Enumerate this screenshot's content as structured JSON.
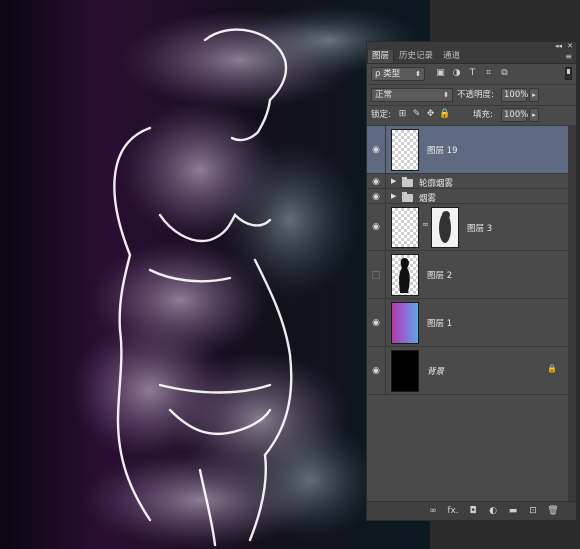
{
  "canvas": {
    "background": "#0b0b14",
    "accent_purple": "#5a2a6e",
    "accent_teal": "#1e4a56"
  },
  "panel": {
    "collapse_glyph": "◂◂",
    "close_glyph": "✕",
    "tabs": [
      {
        "label": "图层",
        "active": true
      },
      {
        "label": "历史记录",
        "active": false
      },
      {
        "label": "通道",
        "active": false
      }
    ],
    "menu_icon": "≡",
    "filter": {
      "label": "ρ 类型",
      "arrow": "⬍"
    },
    "filter_icons": [
      "image-filter-icon",
      "adjustment-filter-icon",
      "type-filter-icon",
      "shape-filter-icon",
      "smart-object-filter-icon"
    ],
    "filter_glyphs": [
      "▣",
      "◑",
      "T",
      "⌗",
      "⧉"
    ],
    "blend_mode": {
      "value": "正常",
      "arrow": "⬍"
    },
    "opacity": {
      "label": "不透明度:",
      "value": "100%",
      "arrow": "▸"
    },
    "lock": {
      "label": "锁定:",
      "glyphs": [
        "⊞",
        "✎",
        "✥",
        "🔒"
      ]
    },
    "fill": {
      "label": "填充:",
      "value": "100%",
      "arrow": "▸"
    },
    "layers": [
      {
        "name": "图层 19",
        "type": "layer",
        "visible": true,
        "selected": true
      },
      {
        "name": "轮廓烟雾",
        "type": "group",
        "visible": true
      },
      {
        "name": "烟雾",
        "type": "group",
        "visible": true
      },
      {
        "name": "图层 3",
        "type": "masked",
        "visible": true
      },
      {
        "name": "图层 2",
        "type": "layer",
        "visible": false
      },
      {
        "name": "图层 1",
        "type": "gradient",
        "visible": true
      },
      {
        "name": "背景",
        "type": "background",
        "visible": true,
        "locked": true
      }
    ],
    "eye_glyph": "◉",
    "group_arrow": "▶",
    "link_glyph": "∞",
    "bg_lock_glyph": "🔒",
    "bottom_icons": [
      "∞",
      "fx.",
      "◘",
      "◐",
      "▬",
      "⊡",
      "🗑"
    ]
  }
}
